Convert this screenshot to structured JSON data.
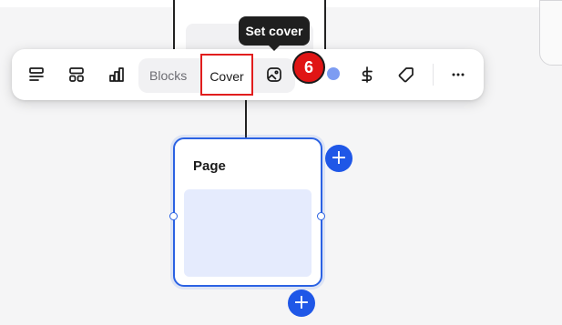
{
  "toolbar": {
    "segmented": {
      "blocks_label": "Blocks",
      "cover_label": "Cover",
      "selected": "Cover"
    },
    "icons": [
      "layout-stack-icon",
      "layout-grid-icon",
      "bar-chart-icon",
      "image-cover-icon",
      "color-swatch-icon",
      "dollar-icon",
      "tag-icon",
      "more-icon"
    ],
    "highlight_color": "#e11d1d"
  },
  "tooltip": {
    "text": "Set cover"
  },
  "step_badge": {
    "number": "6"
  },
  "page_card": {
    "title": "Page"
  },
  "colors": {
    "accent": "#1f57e7",
    "preview": "#e5ebfd",
    "badge": "#e01515"
  }
}
